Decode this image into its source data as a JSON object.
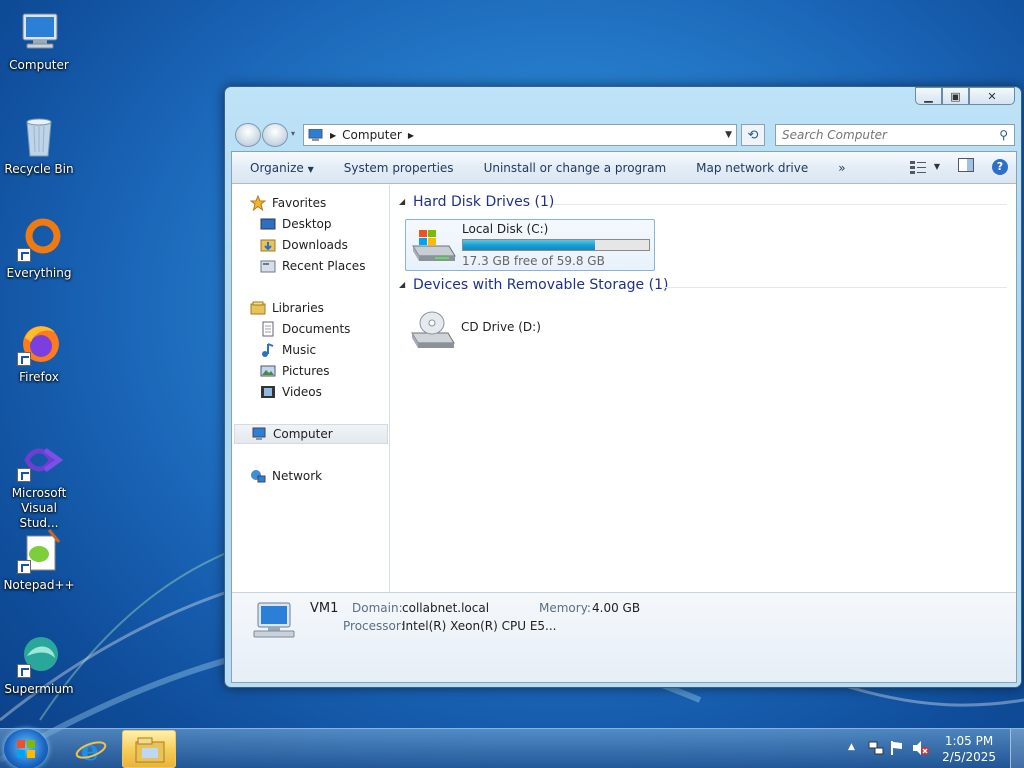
{
  "desktop": {
    "icons": [
      {
        "label": "Computer"
      },
      {
        "label": "Recycle Bin"
      },
      {
        "label": "Everything"
      },
      {
        "label": "Firefox"
      },
      {
        "label": "Microsoft Visual Stud..."
      },
      {
        "label": "Notepad++"
      },
      {
        "label": "Supermium"
      }
    ]
  },
  "window": {
    "address": {
      "segment": "Computer"
    },
    "search": {
      "placeholder": "Search Computer"
    },
    "toolbar": {
      "organize": "Organize",
      "system_properties": "System properties",
      "uninstall": "Uninstall or change a program",
      "map_drive": "Map network drive",
      "more": "»"
    },
    "nav": {
      "favorites": "Favorites",
      "desktop": "Desktop",
      "downloads": "Downloads",
      "recent": "Recent Places",
      "libraries": "Libraries",
      "documents": "Documents",
      "music": "Music",
      "pictures": "Pictures",
      "videos": "Videos",
      "computer": "Computer",
      "network": "Network"
    },
    "groups": {
      "hdd": "Hard Disk Drives (1)",
      "removable": "Devices with Removable Storage (1)"
    },
    "drives": {
      "c": {
        "label": "Local Disk (C:)",
        "free_text": "17.3 GB free of 59.8 GB",
        "used_fraction": 0.71
      },
      "d": {
        "label": "CD Drive (D:)"
      }
    },
    "details": {
      "name": "VM1",
      "domain_key": "Domain:",
      "domain_val": "collabnet.local",
      "memory_key": "Memory:",
      "memory_val": "4.00 GB",
      "processor_key": "Processor:",
      "processor_val": "Intel(R) Xeon(R) CPU E5..."
    }
  },
  "taskbar": {
    "time": "1:05 PM",
    "date": "2/5/2025"
  },
  "colors": {
    "accent": "#1e3287",
    "progress": "#1ba1d3"
  }
}
